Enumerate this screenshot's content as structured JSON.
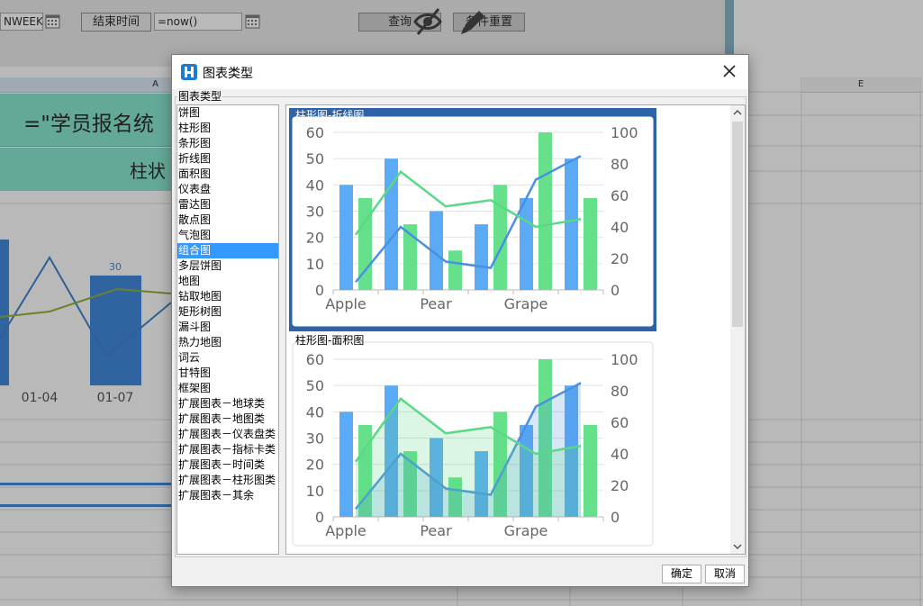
{
  "toolbar": {
    "week_func": "NWEEK(t",
    "end_time_label": "结束时间",
    "end_time_value": "=now()",
    "query_button": "查询",
    "reset_button": "条件重置"
  },
  "sheet": {
    "col_a_header": "A",
    "col_e_header": "E",
    "title_formula": "=\"学员报名统",
    "subtitle": "柱状",
    "chart_value_label": "30",
    "x_labels": [
      "01-04",
      "01-07"
    ]
  },
  "dialog": {
    "title": "图表类型",
    "group_label": "图表类型",
    "chart_types": [
      "饼图",
      "柱形图",
      "条形图",
      "折线图",
      "面积图",
      "仪表盘",
      "雷达图",
      "散点图",
      "气泡图",
      "组合图",
      "多层饼图",
      "地图",
      "钻取地图",
      "矩形树图",
      "漏斗图",
      "热力地图",
      "词云",
      "甘特图",
      "框架图",
      "扩展图表－地球类",
      "扩展图表－地图类",
      "扩展图表－仪表盘类",
      "扩展图表－指标卡类",
      "扩展图表－时间类",
      "扩展图表－柱形图类",
      "扩展图表－其余"
    ],
    "selected_index": 9,
    "ok_button": "确定",
    "cancel_button": "取消",
    "previews": [
      {
        "title": "柱形图-折线图",
        "selected": true
      },
      {
        "title": "柱形图-面积图",
        "selected": false
      }
    ]
  },
  "chart_data": [
    {
      "type": "bar+line",
      "title": "柱形图-折线图",
      "categories": [
        "Apple",
        "",
        "Pear",
        "",
        "Grape",
        ""
      ],
      "series": [
        {
          "values": [
            40,
            50,
            30,
            25,
            35,
            50
          ],
          "axis": "left",
          "kind": "bar",
          "color": "#5aaaf5"
        },
        {
          "values": [
            35,
            25,
            15,
            40,
            60,
            35
          ],
          "axis": "left",
          "kind": "bar",
          "color": "#66e08a"
        },
        {
          "values": [
            5,
            40,
            18,
            14,
            70,
            85
          ],
          "axis": "right",
          "kind": "line",
          "color": "#4a90e2"
        },
        {
          "values": [
            35,
            75,
            53,
            57,
            40,
            45
          ],
          "axis": "right",
          "kind": "line",
          "color": "#5ad886"
        }
      ],
      "y_left": {
        "min": 0,
        "max": 60,
        "ticks": [
          0,
          10,
          20,
          30,
          40,
          50,
          60
        ]
      },
      "y_right": {
        "min": 0,
        "max": 100,
        "ticks": [
          0,
          20,
          40,
          60,
          80,
          100
        ]
      },
      "grid": true
    },
    {
      "type": "bar+area",
      "title": "柱形图-面积图",
      "categories": [
        "Apple",
        "",
        "Pear",
        "",
        "Grape",
        ""
      ],
      "series": [
        {
          "values": [
            40,
            50,
            30,
            25,
            35,
            50
          ],
          "axis": "left",
          "kind": "bar",
          "color": "#5aaaf5"
        },
        {
          "values": [
            35,
            25,
            15,
            40,
            60,
            35
          ],
          "axis": "left",
          "kind": "bar",
          "color": "#66e08a"
        },
        {
          "values": [
            5,
            40,
            18,
            14,
            70,
            85
          ],
          "axis": "right",
          "kind": "area",
          "color": "#4a90e2"
        },
        {
          "values": [
            35,
            75,
            53,
            57,
            40,
            45
          ],
          "axis": "right",
          "kind": "area",
          "color": "#5ad886"
        }
      ],
      "y_left": {
        "min": 0,
        "max": 60,
        "ticks": [
          0,
          10,
          20,
          30,
          40,
          50,
          60
        ]
      },
      "y_right": {
        "min": 0,
        "max": 100,
        "ticks": [
          0,
          20,
          40,
          60,
          80,
          100
        ]
      },
      "grid": true
    }
  ]
}
